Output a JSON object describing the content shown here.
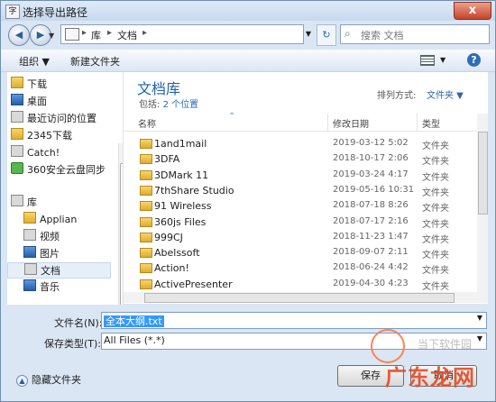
{
  "window": {
    "title": "选择导出路径",
    "icon": "app-icon",
    "close_label": "x"
  },
  "nav": {
    "back": "◀",
    "forward": "▶",
    "dropdown": "▼",
    "breadcrumb": [
      "库",
      "文档"
    ],
    "refresh": "↻",
    "search_placeholder": "搜索 文档"
  },
  "toolbar": {
    "organize": "组织 ▼",
    "new_folder": "新建文件夹",
    "view_dropdown": "▼",
    "help": "?"
  },
  "sidebar": {
    "items": [
      {
        "label": "下载",
        "icon": "download-folder-icon"
      },
      {
        "label": "桌面",
        "icon": "desktop-icon"
      },
      {
        "label": "最近访问的位置",
        "icon": "recent-places-icon"
      },
      {
        "label": "2345下载",
        "icon": "folder-icon"
      },
      {
        "label": "Catch!",
        "icon": "document-icon"
      },
      {
        "label": "360安全云盘同步",
        "icon": "cloud-sync-icon"
      },
      {
        "label": "库",
        "icon": "library-icon"
      },
      {
        "label": "Applian",
        "icon": "folder-icon"
      },
      {
        "label": "视频",
        "icon": "video-library-icon"
      },
      {
        "label": "图片",
        "icon": "picture-library-icon"
      },
      {
        "label": "文档",
        "icon": "document-library-icon"
      },
      {
        "label": "音乐",
        "icon": "music-library-icon"
      }
    ]
  },
  "library": {
    "title": "文档库",
    "includes": "包括:",
    "locations": "2 个位置",
    "sort_label": "排列方式:",
    "sort_value": "文件夹 ▼"
  },
  "columns": {
    "name": "名称",
    "date": "修改日期",
    "type": "类型"
  },
  "files": [
    {
      "name": "1and1mail",
      "date": "2019-03-12  5:02",
      "type": "文件夹"
    },
    {
      "name": "3DFA",
      "date": "2018-10-17  2:06",
      "type": "文件夹"
    },
    {
      "name": "3DMark 11",
      "date": "2019-03-24  4:17",
      "type": "文件夹"
    },
    {
      "name": "7thShare Studio",
      "date": "2019-05-16  10:31",
      "type": "文件夹"
    },
    {
      "name": "91 Wireless",
      "date": "2018-07-18  8:26",
      "type": "文件夹"
    },
    {
      "name": "360js Files",
      "date": "2018-07-17  2:16",
      "type": "文件夹"
    },
    {
      "name": "999CJ",
      "date": "2018-11-23  1:47",
      "type": "文件夹"
    },
    {
      "name": "Abelssoft",
      "date": "2018-09-07  2:11",
      "type": "文件夹"
    },
    {
      "name": "Action!",
      "date": "2018-06-24  4:42",
      "type": "文件夹"
    },
    {
      "name": "ActivePresenter",
      "date": "2019-04-30  4:23",
      "type": "文件夹"
    }
  ],
  "form": {
    "filename_label": "文件名(N):",
    "filename_value": "全本大纲.txt",
    "filetype_label": "保存类型(T):",
    "filetype_value": "All Files (*.*)"
  },
  "footer": {
    "hide_folders": "隐藏文件夹",
    "save": "保存",
    "cancel": "取消"
  },
  "watermark": {
    "big": "广东龙网",
    "small": "当下软件园"
  }
}
